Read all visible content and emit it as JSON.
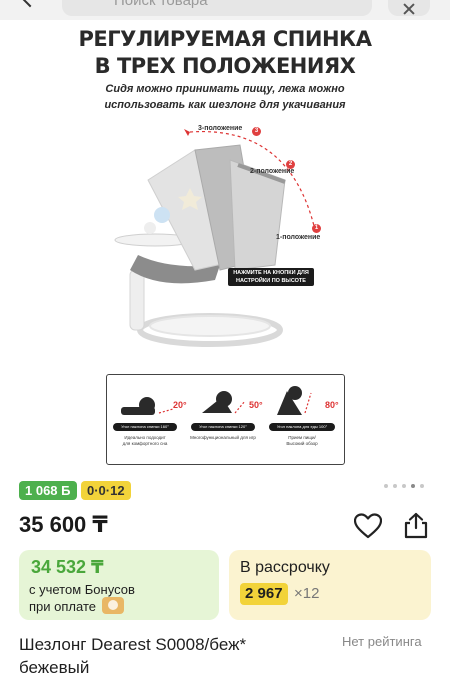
{
  "search": {
    "placeholder": "Поиск товара"
  },
  "image": {
    "title_line1": "РЕГУЛИРУЕМАЯ СПИНКА",
    "title_line2": "В ТРЕХ ПОЛОЖЕНИЯХ",
    "subtitle_line1": "Сидя можно принимать пищу, лежа можно",
    "subtitle_line2": "использовать как шезлонг для укачивания",
    "positions": [
      {
        "num": "1",
        "label": "1-положение"
      },
      {
        "num": "2",
        "label": "2-положение"
      },
      {
        "num": "3",
        "label": "3-положение"
      }
    ],
    "button_note_line1": "НАЖМИТЕ НА КНОПКИ ДЛЯ",
    "button_note_line2": "НАСТРОЙКИ ПО ВЫСОТЕ",
    "modes": [
      {
        "angle": "20°",
        "caption": "Угол наклона спинки 160°",
        "desc_line1": "Идеально подходит",
        "desc_line2": "для комфортного сна"
      },
      {
        "angle": "50°",
        "caption": "Угол наклона спинки 120°",
        "desc_line1": "Многофункциональный для игр",
        "desc_line2": ""
      },
      {
        "angle": "80°",
        "caption": "Угол наклона для еды 100°",
        "desc_line1": "Прием пищи/",
        "desc_line2": "Высокий обзор"
      }
    ]
  },
  "badges": {
    "bonus": "1 068 Б",
    "installment": "0·0·12"
  },
  "gallery": {
    "dot_count": 5,
    "active_dot": 4
  },
  "price": "35 600 ₸",
  "bonus_card": {
    "amount": "34 532 ₸",
    "line1": "с учетом Бонусов",
    "line2": "при оплате"
  },
  "installment_card": {
    "title": "В рассрочку",
    "amount": "2 967",
    "multiplier": "×12"
  },
  "product": {
    "name": "Шезлонг Dearest S0008/беж* бежевый",
    "rating": "Нет рейтинга"
  },
  "colors": {
    "accent_green": "#4aa73b",
    "badge_yellow": "#f2d33a",
    "card_green_bg": "#e6f5d6",
    "card_yellow_bg": "#fbf3d0",
    "angle_red": "#dd3333"
  }
}
